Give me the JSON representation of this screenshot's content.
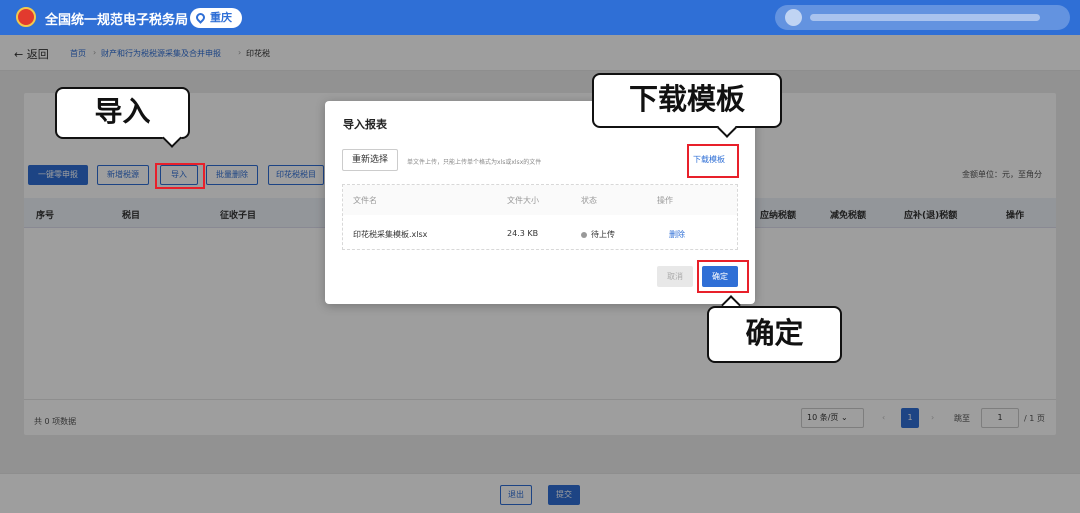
{
  "header": {
    "app_title": "全国统一规范电子税务局",
    "region": "重庆"
  },
  "breadcrumb": {
    "back": "← 返回",
    "items": [
      "首页",
      "财产和行为税税源采集及合并申报",
      "印花税"
    ]
  },
  "toolbar": {
    "buttons": [
      "一键零申报",
      "新增税源",
      "导入",
      "批量删除",
      "印花税税目"
    ],
    "unit_note": "金额单位：元，至角分"
  },
  "table": {
    "columns": [
      "序号",
      "税目",
      "征收子目",
      "应纳税额",
      "减免税额",
      "应补(退)税额",
      "操作"
    ]
  },
  "pagination": {
    "total": "共 0 项数据",
    "page_size": "10 条/页",
    "current_page": "1",
    "goto_label": "跳至",
    "goto_value": "1",
    "total_pages": "/ 1 页"
  },
  "footer": {
    "exit": "退出",
    "submit": "提交"
  },
  "modal": {
    "title": "导入报表",
    "reselect": "重新选择",
    "hint": "单文件上传，只能上传单个格式为xls或xlsx的文件",
    "download_template": "下载模板",
    "file_columns": [
      "文件名",
      "文件大小",
      "状态",
      "操作"
    ],
    "file": {
      "name": "印花税采集模板.xlsx",
      "size": "24.3 KB",
      "status": "待上传",
      "action": "删除"
    },
    "cancel": "取消",
    "confirm": "确定"
  },
  "callouts": {
    "import": "导入",
    "download": "下载模板",
    "confirm": "确定"
  },
  "colors": {
    "brand_blue": "#2f6fd6",
    "highlight_red": "#e8202a"
  }
}
